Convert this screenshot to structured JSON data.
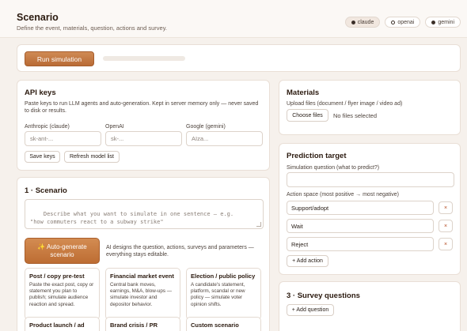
{
  "header": {
    "title": "Scenario",
    "subtitle": "Define the event, materials, question, actions and survey.",
    "providers": [
      {
        "label": "claude",
        "dot": "filled",
        "active": true
      },
      {
        "label": "openai",
        "dot": "ring",
        "active": false
      },
      {
        "label": "gemini",
        "dot": "filled",
        "active": false
      }
    ]
  },
  "run": {
    "button_label": "Run simulation",
    "progress_fraction": 0.0
  },
  "api_keys": {
    "title": "API keys",
    "description": "Paste keys to run LLM agents and auto-generation. Kept in server memory only — never saved to disk or results.",
    "fields": [
      {
        "label": "Anthropic (claude)",
        "placeholder": "sk-ant-..."
      },
      {
        "label": "OpenAI",
        "placeholder": "sk-..."
      },
      {
        "label": "Google (gemini)",
        "placeholder": "AIza..."
      }
    ],
    "save_label": "Save keys",
    "refresh_label": "Refresh model list"
  },
  "scenario": {
    "title": "1 · Scenario",
    "placeholder": "Describe what you want to simulate in one sentence — e.g.\n\"how commuters react to a subway strike\"",
    "autogen_label": "✨ Auto-generate scenario",
    "autogen_note": "AI designs the question, actions, surveys and parameters — everything stays editable.",
    "templates": [
      {
        "title": "Post / copy pre-test",
        "desc": "Paste the exact post, copy or statement you plan to publish; simulate audience reaction and spread."
      },
      {
        "title": "Financial market event",
        "desc": "Central bank moves, earnings, M&A, blow-ups — simulate investor and depositor behavior."
      },
      {
        "title": "Election / public policy",
        "desc": "A candidate's statement, platform, scandal or new policy — simulate voter opinion shifts."
      },
      {
        "title": "Product launch / ad",
        "desc": ""
      },
      {
        "title": "Brand crisis / PR",
        "desc": ""
      },
      {
        "title": "Custom scenario",
        "desc": ""
      }
    ]
  },
  "materials": {
    "title": "Materials",
    "description": "Upload files (document / flyer image / video ad)",
    "choose_label": "Choose files",
    "status": "No files selected"
  },
  "prediction": {
    "title": "Prediction target",
    "question_label": "Simulation question (what to predict?)",
    "question_value": "",
    "action_label": "Action space (most positive → most negative)",
    "actions": [
      "Support/adopt",
      "Wait",
      "Reject"
    ],
    "remove_symbol": "×",
    "add_label": "+ Add action"
  },
  "survey": {
    "title": "3 · Survey questions",
    "add_label": "+ Add question"
  }
}
